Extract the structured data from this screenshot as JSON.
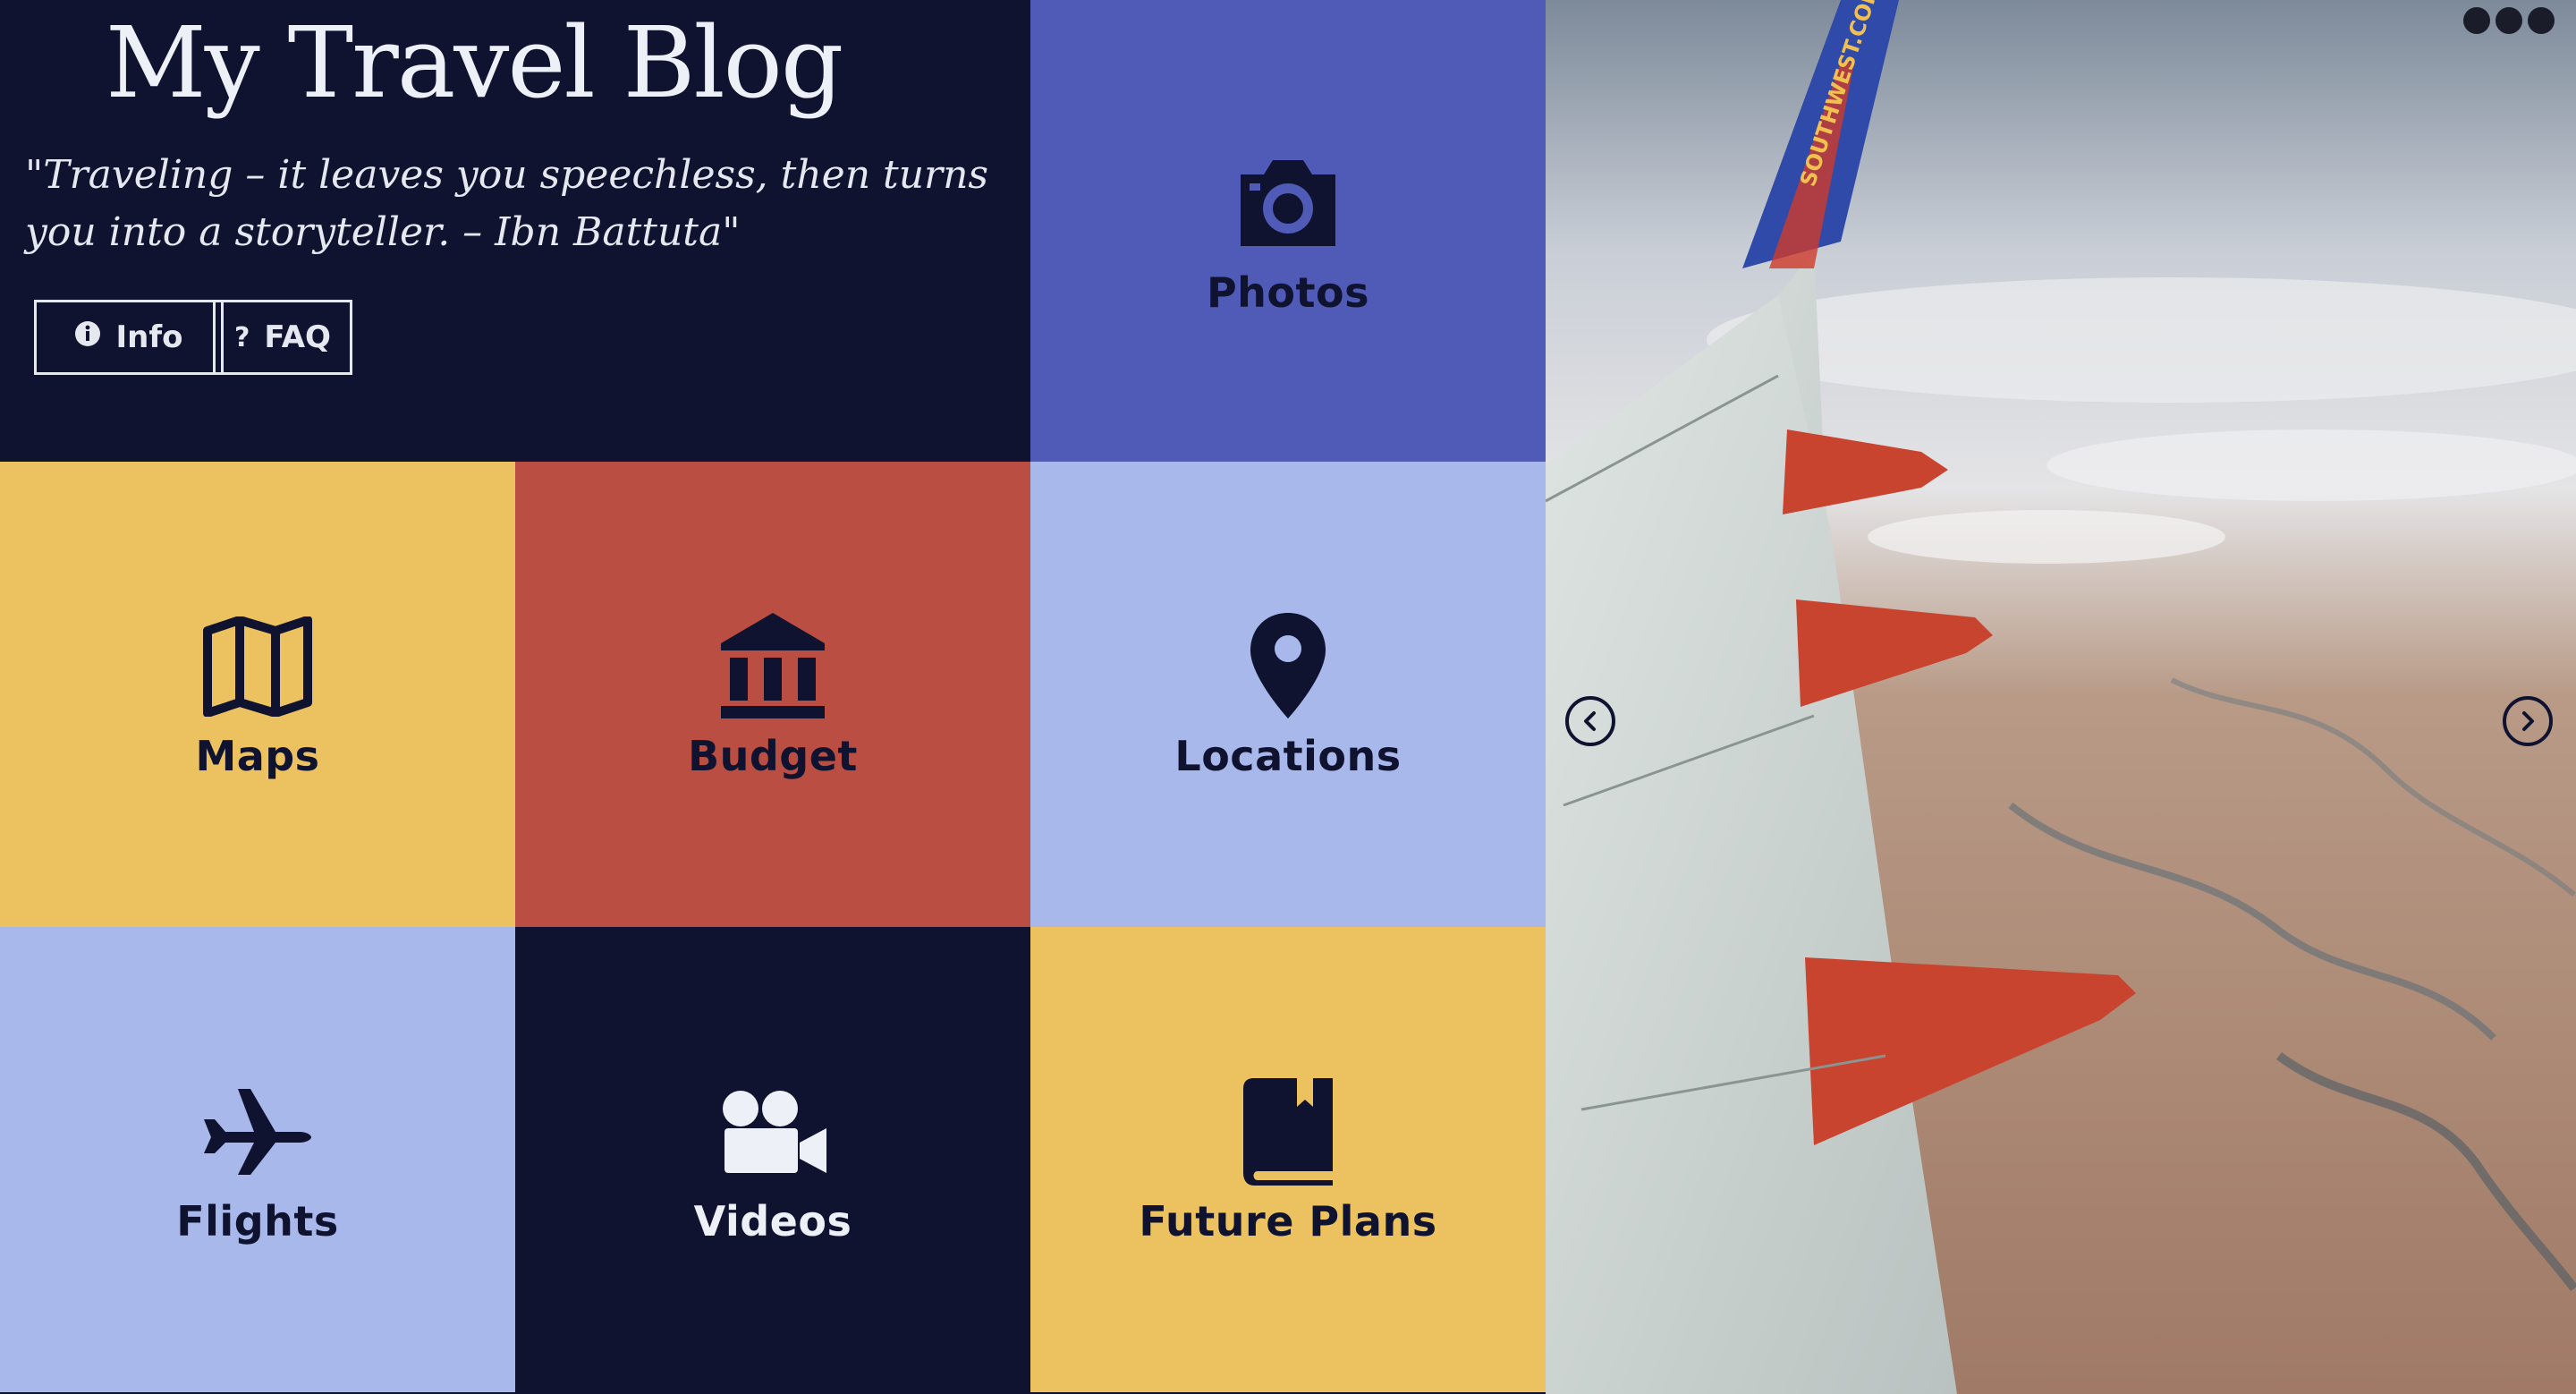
{
  "header": {
    "title": "My Travel Blog",
    "quote": "\"Traveling – it leaves you speechless, then turns you into a storyteller. – Ibn Battuta\"",
    "buttons": [
      {
        "label": "Info",
        "icon": "info-icon",
        "glyph": "i"
      },
      {
        "label": "FAQ",
        "icon": "question-icon",
        "glyph": "?"
      }
    ]
  },
  "tiles": [
    {
      "label": "Photos",
      "icon": "camera-icon",
      "color": "#4f5bb7"
    },
    {
      "label": "Maps",
      "icon": "map-icon",
      "color": "#ecc260"
    },
    {
      "label": "Budget",
      "icon": "bank-icon",
      "color": "#bb4e42"
    },
    {
      "label": "Locations",
      "icon": "map-pin-icon",
      "color": "#a8b8ea"
    },
    {
      "label": "Flights",
      "icon": "plane-icon",
      "color": "#a8b8ea"
    },
    {
      "label": "Videos",
      "icon": "video-camera-icon",
      "color": "#0f1330"
    },
    {
      "label": "Future Plans",
      "icon": "book-icon",
      "color": "#ecc260"
    }
  ],
  "photo": {
    "wing_text": "SOUTHWEST.COM",
    "prev_icon": "chevron-left-icon",
    "next_icon": "chevron-right-icon"
  },
  "colors": {
    "navy": "#0f1330",
    "text_light": "#eef0f7"
  }
}
